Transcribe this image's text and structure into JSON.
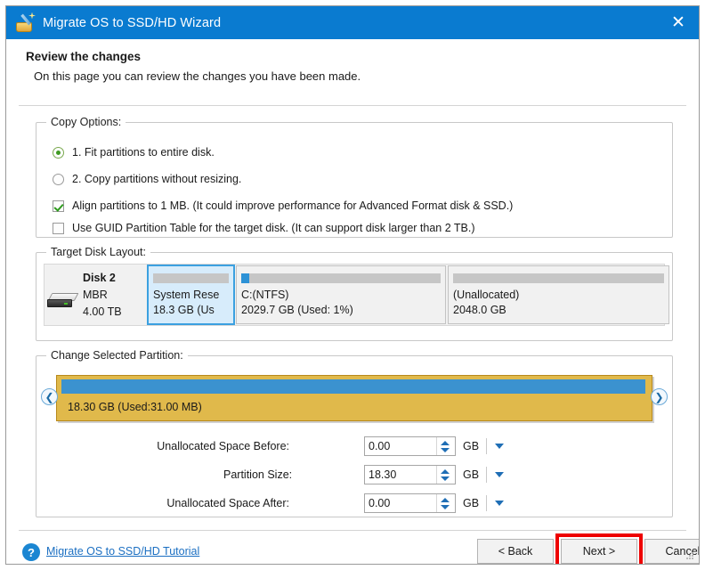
{
  "window": {
    "title": "Migrate OS to SSD/HD Wizard",
    "close_label": "✕",
    "icon": "wizard-disk-icon"
  },
  "header": {
    "title": "Review the changes",
    "subtitle": "On this page you can review the changes you have been made."
  },
  "copy_options": {
    "legend": "Copy Options:",
    "items": [
      {
        "type": "radio",
        "checked": true,
        "label": "1. Fit partitions to entire disk."
      },
      {
        "type": "radio",
        "checked": false,
        "label": "2. Copy partitions without resizing."
      },
      {
        "type": "checkbox",
        "checked": true,
        "label": "Align partitions to 1 MB.  (It could improve performance for Advanced Format disk & SSD.)"
      },
      {
        "type": "checkbox",
        "checked": false,
        "label": "Use GUID Partition Table for the target disk. (It can support disk larger than 2 TB.)"
      }
    ]
  },
  "target_disk": {
    "legend": "Target Disk Layout:",
    "disk": {
      "name": "Disk 2",
      "scheme": "MBR",
      "size": "4.00 TB",
      "icon": "hard-disk-icon"
    },
    "partitions": [
      {
        "name": "System Rese",
        "size": "18.3 GB (Us",
        "used_pct": 0,
        "selected": true,
        "unallocated": false
      },
      {
        "name": "C:(NTFS)",
        "size": "2029.7 GB (Used: 1%)",
        "used_pct": 4,
        "selected": false,
        "unallocated": false
      },
      {
        "name": "(Unallocated)",
        "size": "2048.0 GB",
        "used_pct": 0,
        "selected": false,
        "unallocated": true
      }
    ]
  },
  "change_partition": {
    "legend": "Change Selected Partition:",
    "bar_label": "18.30 GB (Used:31.00 MB)",
    "left_arrow": "❮",
    "right_arrow": "❯",
    "used_fill_pct": 99,
    "fields": [
      {
        "label": "Unallocated Space Before:",
        "value": "0.00",
        "unit": "GB"
      },
      {
        "label": "Partition Size:",
        "value": "18.30",
        "unit": "GB"
      },
      {
        "label": "Unallocated Space After:",
        "value": "0.00",
        "unit": "GB"
      }
    ]
  },
  "footer": {
    "help_icon_label": "?",
    "tutorial_link": "Migrate OS to SSD/HD Tutorial",
    "back_label": "< Back",
    "next_label": "Next >",
    "cancel_label": "Cancel"
  },
  "colors": {
    "titlebar": "#0a7bd0",
    "accent_blue": "#3b92cf",
    "partition_gold": "#e0b94b",
    "selected_partition": "#d7ecfb",
    "highlight_red": "#ee0000",
    "link": "#1b6fc2"
  }
}
